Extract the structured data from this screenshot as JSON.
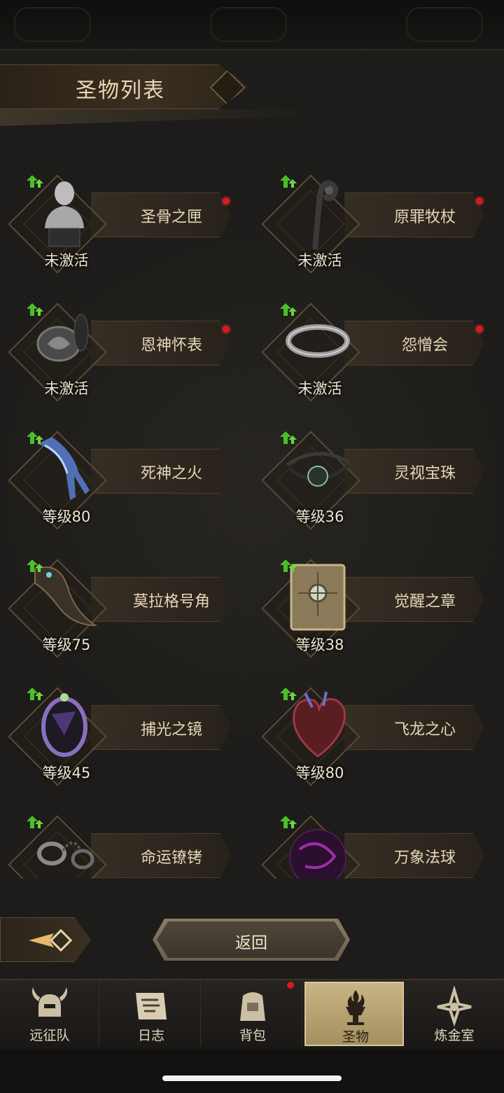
{
  "header": {
    "title": "圣物列表"
  },
  "relics": [
    {
      "name": "圣骨之匣",
      "status": "未激活",
      "has_dot": true,
      "icon": "bust-icon"
    },
    {
      "name": "原罪牧杖",
      "status": "未激活",
      "has_dot": true,
      "icon": "crook-staff-icon"
    },
    {
      "name": "恩神怀表",
      "status": "未激活",
      "has_dot": true,
      "icon": "pocket-watch-icon"
    },
    {
      "name": "怨憎会",
      "status": "未激活",
      "has_dot": true,
      "icon": "bracelet-icon"
    },
    {
      "name": "死神之火",
      "status": "等级80",
      "has_dot": false,
      "icon": "spectral-hand-icon"
    },
    {
      "name": "灵视宝珠",
      "status": "等级36",
      "has_dot": false,
      "icon": "circlet-orb-icon"
    },
    {
      "name": "莫拉格号角",
      "status": "等级75",
      "has_dot": false,
      "icon": "horn-icon"
    },
    {
      "name": "觉醒之章",
      "status": "等级38",
      "has_dot": false,
      "icon": "tome-icon"
    },
    {
      "name": "捕光之镜",
      "status": "等级45",
      "has_dot": false,
      "icon": "mirror-icon"
    },
    {
      "name": "飞龙之心",
      "status": "等级80",
      "has_dot": false,
      "icon": "dragon-heart-icon"
    },
    {
      "name": "命运镣铐",
      "status": "",
      "has_dot": false,
      "icon": "shackles-icon"
    },
    {
      "name": "万象法球",
      "status": "",
      "has_dot": false,
      "icon": "purple-orb-icon"
    }
  ],
  "actions": {
    "back_label": "返回"
  },
  "nav": {
    "tabs": [
      {
        "label": "远征队",
        "icon": "horned-helmet-icon"
      },
      {
        "label": "日志",
        "icon": "scroll-icon"
      },
      {
        "label": "背包",
        "icon": "bag-icon"
      },
      {
        "label": "圣物",
        "icon": "brazier-icon",
        "active": true
      },
      {
        "label": "炼金室",
        "icon": "alchemy-icon"
      }
    ],
    "badge_on": "背包"
  },
  "colors": {
    "accent": "#c9b483",
    "text": "#e6d7b6",
    "dot": "#d41c1c",
    "up_arrow": "#4bbf2a"
  }
}
